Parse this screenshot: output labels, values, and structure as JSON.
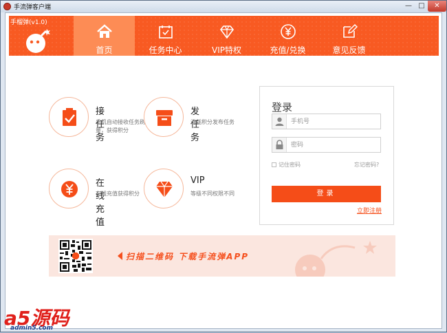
{
  "window": {
    "title": "手流弹客户端",
    "min_glyph": "—",
    "max_glyph": "□",
    "close_glyph": "✕"
  },
  "header": {
    "version": "手榴弹(v1.0)",
    "logo_icon": "bomb-icon",
    "nav": [
      {
        "label": "首页",
        "icon": "home-icon",
        "active": true
      },
      {
        "label": "任务中心",
        "icon": "calendar-check-icon",
        "active": false
      },
      {
        "label": "VIP特权",
        "icon": "diamond-icon",
        "active": false
      },
      {
        "label": "充值/兑换",
        "icon": "yen-icon",
        "active": false
      },
      {
        "label": "意见反馈",
        "icon": "edit-icon",
        "active": false
      }
    ]
  },
  "features": [
    {
      "title": "接任务",
      "desc": "手机自动接收任务刷流量，获得积分",
      "icon": "clipboard-check-icon"
    },
    {
      "title": "发任务",
      "desc": "消耗积分发布任务",
      "icon": "archive-box-icon"
    },
    {
      "title": "在线充值",
      "desc": "在线充值获得积分",
      "icon": "yen-icon"
    },
    {
      "title": "VIP",
      "desc": "等级不同权限不同",
      "icon": "diamond-icon"
    }
  ],
  "login": {
    "title": "登录",
    "phone_placeholder": "手机号",
    "password_placeholder": "密码",
    "remember_label": "记住密码",
    "forgot_label": "忘记密码?",
    "submit_label": "登录",
    "register_label": "立即注册"
  },
  "banner": {
    "text": "扫描二维码  下载手流弹APP"
  },
  "watermark": {
    "logo_text": "a5源码",
    "url": "admin5.com"
  },
  "colors": {
    "accent": "#f54d18",
    "header": "#f85a22",
    "nav_active": "#fd8c55",
    "banner_bg": "#fbe6df"
  }
}
